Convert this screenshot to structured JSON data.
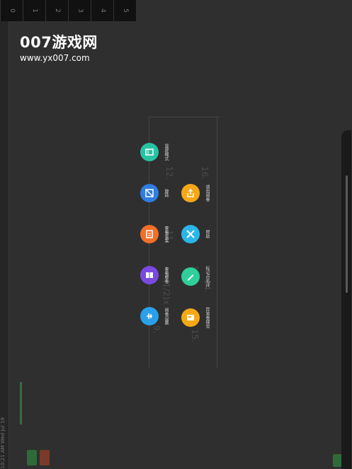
{
  "tabs": [
    "0",
    "1",
    "2",
    "3",
    "4",
    "5"
  ],
  "watermark": {
    "title": "007游戏网",
    "url": "www.yx007.com"
  },
  "left_status": {
    "text": "10:21 AM  Wed Jul 19"
  },
  "menu": [
    {
      "label": "竖屏模式",
      "color": "#27c3a2",
      "icon": "screen-mode-icon"
    },
    {
      "label": "旋转",
      "color": "#2f7de0",
      "icon": "rotate-icon"
    },
    {
      "label": "退出阅卷",
      "color": "#f5a816",
      "icon": "exit-icon"
    },
    {
      "label": "查看答案",
      "color": "#f07028",
      "icon": "answer-icon"
    },
    {
      "label": "帮助",
      "color": "#2bb5e8",
      "icon": "help-icon"
    },
    {
      "label": "查看整卷",
      "color": "#7a49e0",
      "icon": "full-paper-icon"
    },
    {
      "label": "标记点名评",
      "color": "#2ecf9a",
      "icon": "mark-icon"
    },
    {
      "label": "阅卷设置",
      "color": "#2aa0e8",
      "icon": "settings-icon"
    },
    {
      "label": "异常卷提交",
      "color": "#f5a816",
      "icon": "submit-icon"
    }
  ],
  "paper_text": [
    "9.",
    "(1/2)x",
    "15.",
    "12.",
    "16.",
    "13.",
    "14.",
    "11."
  ]
}
